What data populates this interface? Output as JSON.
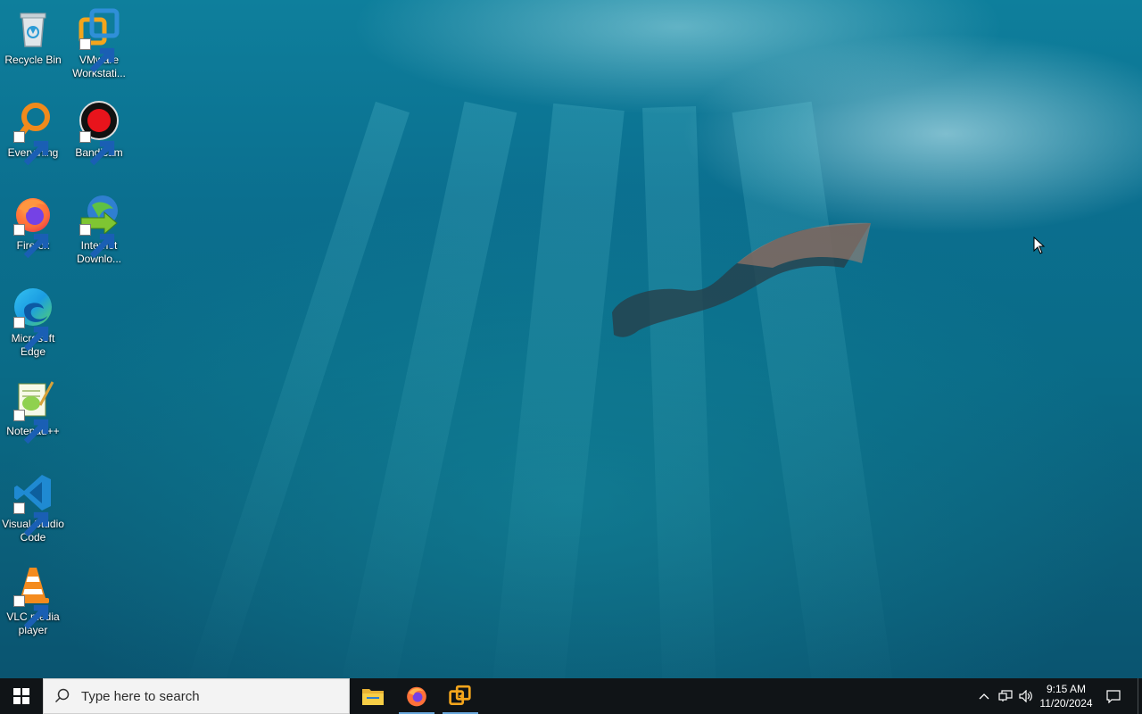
{
  "desktop": {
    "icons": [
      {
        "label": "Recycle Bin",
        "icon": "recycle-bin-icon"
      },
      {
        "label": "VMware Workstati...",
        "icon": "vmware-icon"
      },
      {
        "label": "Everything",
        "icon": "everything-search-icon"
      },
      {
        "label": "Bandicam",
        "icon": "bandicam-record-icon"
      },
      {
        "label": "Firefox",
        "icon": "firefox-icon"
      },
      {
        "label": "Internet Downlo...",
        "icon": "internet-download-manager-icon"
      },
      {
        "label": "Microsoft Edge",
        "icon": "edge-icon"
      },
      {
        "label": "Notepad++",
        "icon": "notepad-plus-plus-icon"
      },
      {
        "label": "Visual Studio Code",
        "icon": "vscode-icon"
      },
      {
        "label": "VLC media player",
        "icon": "vlc-icon"
      }
    ]
  },
  "taskbar": {
    "search_placeholder": "Type here to search",
    "pinned": [
      {
        "name": "File Explorer",
        "icon": "folder-icon",
        "active": false
      },
      {
        "name": "Firefox",
        "icon": "firefox-icon",
        "active": true
      },
      {
        "name": "VMware Workstation",
        "icon": "vmware-icon",
        "active": true
      }
    ],
    "tray": {
      "icons": [
        "chevron-up-icon",
        "network-icon",
        "volume-icon"
      ],
      "time": "9:15 AM",
      "date": "11/20/2024",
      "notification_icon": "action-center-icon"
    }
  },
  "colors": {
    "taskbar_bg": "#101417",
    "active_underline": "#6aa8dc",
    "water": "#0b6f8f"
  }
}
